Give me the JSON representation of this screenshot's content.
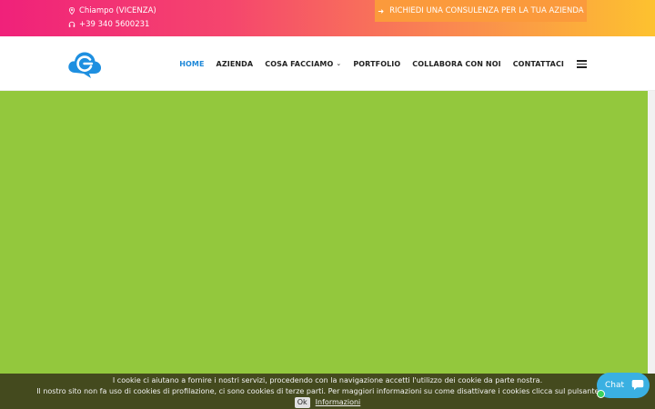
{
  "topbar": {
    "location": "Chiampo (VICENZA)",
    "phone": "+39 340 5600231",
    "cta_label": "RICHIEDI UNA CONSULENZA PER LA TUA AZIENDA"
  },
  "nav": {
    "items": [
      {
        "label": "HOME",
        "active": true
      },
      {
        "label": "AZIENDA"
      },
      {
        "label": "COSA FACCIAMO",
        "dropdown": true
      },
      {
        "label": "PORTFOLIO"
      },
      {
        "label": "COLLABORA CON NOI"
      },
      {
        "label": "CONTATTACI"
      }
    ]
  },
  "cookie": {
    "line1": "I cookie ci aiutano a fornire i nostri servizi, procedendo con la navigazione accetti l'utilizzo dei cookie da parte nostra.",
    "line2": "Il nostro sito non fa uso di cookies di profilazione, ci sono cookies di terze parti. Per maggiori informazioni su come disattivare i cookies clicca sul pulsante \"Info",
    "ok_label": "Ok",
    "info_label": "Informazioni"
  },
  "chat": {
    "label": "Chat"
  },
  "colors": {
    "hero_green": "#93c83d",
    "nav_active": "#1e88d8",
    "cta_orange": "#fb9a3c",
    "chat_blue": "#3ab0e2"
  },
  "icons": [
    "map-pin-icon",
    "headset-icon",
    "arrow-right-icon",
    "chevron-down-icon",
    "hamburger-menu-icon",
    "chat-bubble-icon",
    "logo-cloud-icon"
  ]
}
